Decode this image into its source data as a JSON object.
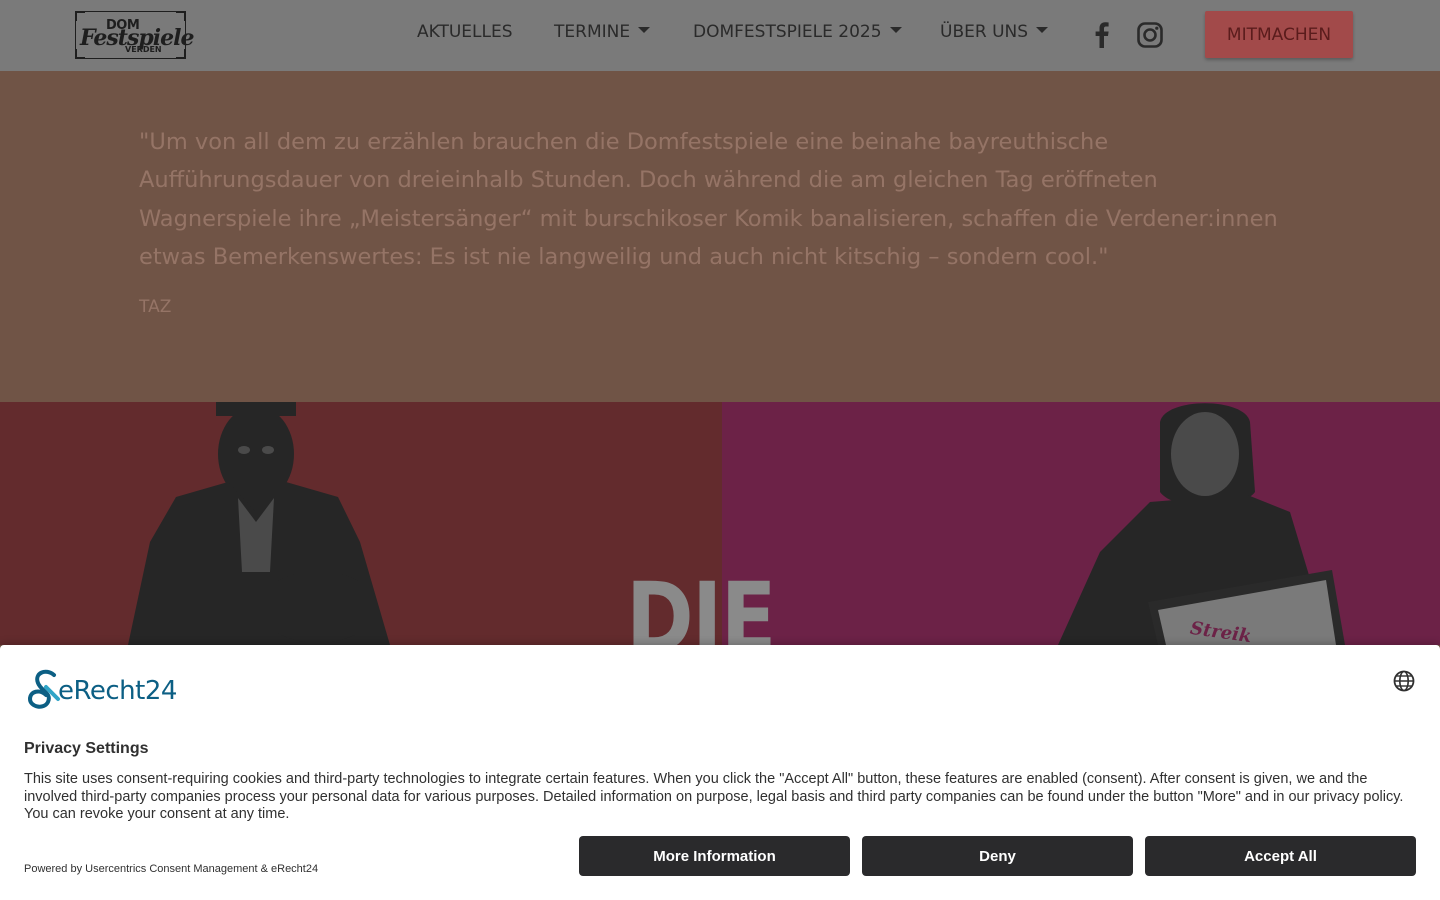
{
  "header": {
    "logo": {
      "line1": "DOM",
      "line2": "Festspiele",
      "line3": "VERDEN"
    },
    "nav": [
      {
        "label": "AKTUELLES",
        "has_dropdown": false
      },
      {
        "label": "TERMINE",
        "has_dropdown": true
      },
      {
        "label": "DOMFESTSPIELE 2025",
        "has_dropdown": true
      },
      {
        "label": "ÜBER UNS",
        "has_dropdown": true
      }
    ],
    "social": [
      "facebook-icon",
      "instagram-icon"
    ],
    "cta_label": "MITMACHEN"
  },
  "testimonial": {
    "quote": "\"Um von all dem zu erzählen brauchen die Domfestspiele eine beinahe bayreuthische Aufführungsdauer von dreieinhalb Stunden. Doch während die am gleichen Tag eröffneten Wagnerspiele ihre „Meistersänger“ mit burschikoser Komik banalisieren, schaffen die Verdener:innen etwas Bemerkenswertes: Es ist nie langweilig und auch nicht kitschig – sondern cool.\"",
    "author": "TAZ"
  },
  "hero": {
    "title": "DIE",
    "sign_text": "Streik"
  },
  "consent": {
    "brand": "eRecht24",
    "title": "Privacy Settings",
    "text": "This site uses consent-requiring cookies and third-party technologies to integrate certain features. When you click the \"Accept All\" button, these features are enabled (consent). After consent is given, we and the involved third-party companies process your personal data for various purposes. Detailed information on purpose, legal basis and third party companies can be found under the button \"More\" and in our privacy policy. You can revoke your consent at any time.",
    "powered_by": "Powered by Usercentrics Consent Management & eRecht24",
    "buttons": {
      "more": "More Information",
      "deny": "Deny",
      "accept": "Accept All"
    }
  },
  "colors": {
    "header_bg": "#7a7a7a",
    "section_bg": "#705446",
    "cta_bg": "#a24a4a",
    "hero_left_bg": "#632b2d",
    "hero_right_bg": "#6c2247",
    "brand_blue": "#0c5f84",
    "consent_button_bg": "#2a2a2c"
  }
}
